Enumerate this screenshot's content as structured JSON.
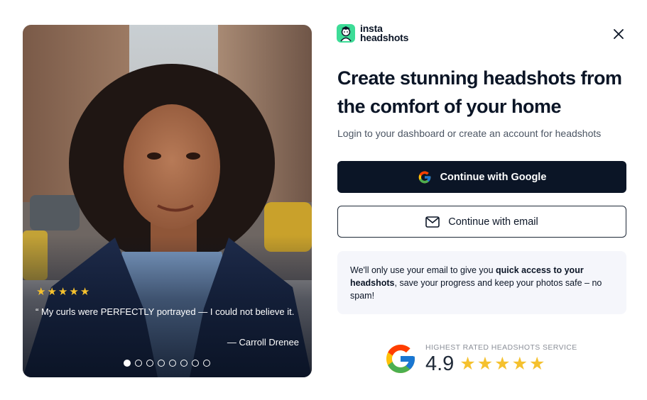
{
  "brand": {
    "line1": "insta",
    "line2": "headshots",
    "accent": "#3ddc97"
  },
  "testimonial": {
    "stars": [
      "★",
      "★",
      "★",
      "★",
      "★"
    ],
    "quote": "“ My curls were PERFECTLY portrayed — I could not believe it.",
    "author": "— Carroll Drenee",
    "slides": [
      true,
      false,
      false,
      false,
      false,
      false,
      false,
      false
    ]
  },
  "headline": "Create stunning headshots from the comfort of your home",
  "subtitle": "Login to your dashboard or create an account for headshots",
  "buttons": {
    "google": "Continue with Google",
    "email": "Continue with email"
  },
  "note": {
    "before": "We'll only use your email to give you ",
    "bold": "quick access to your headshots",
    "after": ", save your progress and keep your photos safe – no spam!"
  },
  "rating": {
    "caption": "HIGHEST RATED HEADSHOTS SERVICE",
    "score": "4.9",
    "stars": [
      "★",
      "★",
      "★",
      "★",
      "★"
    ]
  },
  "colors": {
    "primary": "#0b1526",
    "star": "#f5c12e",
    "note_bg": "#f5f6fb"
  },
  "icons": [
    "close-icon",
    "google-icon",
    "mail-icon",
    "star-icon",
    "google-logo-icon"
  ]
}
